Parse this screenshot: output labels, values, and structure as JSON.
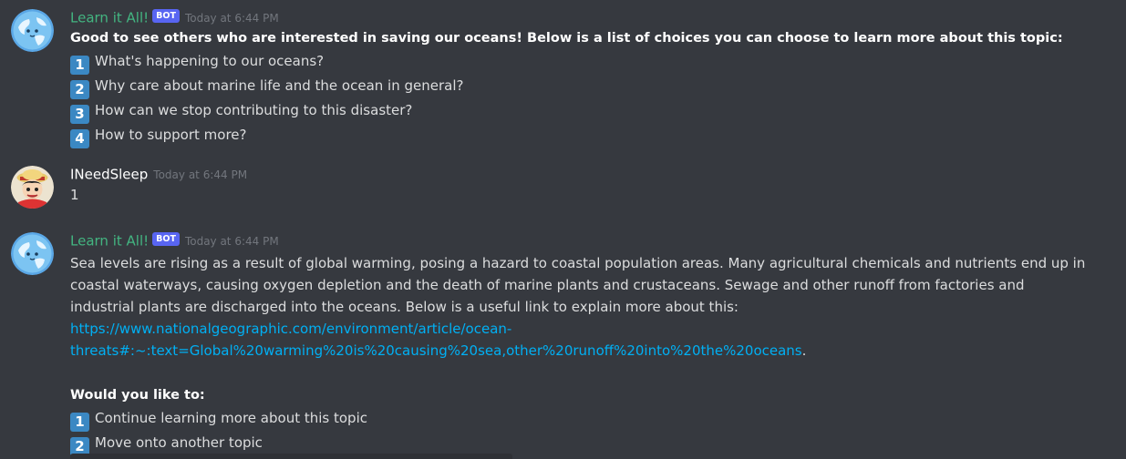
{
  "bot": {
    "name": "Learn it All!",
    "tag": "BOT",
    "avatar_icon": "globe-icon",
    "name_color": "#43b581"
  },
  "user": {
    "name": "INeedSleep",
    "avatar_icon": "anime-avatar-icon"
  },
  "messages": [
    {
      "author": "bot",
      "timestamp": "Today at 6:44 PM",
      "heading": "Good to see others who are interested in saving our oceans! Below is a list of choices you can choose to learn more about this topic:",
      "options": [
        {
          "num": "1",
          "text": "What's happening to our oceans?"
        },
        {
          "num": "2",
          "text": "Why care about marine life and the ocean in general?"
        },
        {
          "num": "3",
          "text": "How can we stop contributing to this disaster?"
        },
        {
          "num": "4",
          "text": "How to support more?"
        }
      ]
    },
    {
      "author": "user",
      "timestamp": "Today at 6:44 PM",
      "text": "1"
    },
    {
      "author": "bot",
      "timestamp": "Today at 6:44 PM",
      "paragraph": "Sea levels are rising as a result of global warming, posing a hazard to coastal population areas. Many agricultural chemicals and nutrients end up in coastal waterways, causing oxygen depletion and the death of marine plants and crustaceans. Sewage and other runoff from factories and industrial plants are discharged into the oceans. Below is a useful link to explain more about this:",
      "link_line1": "https://www.nationalgeographic.com/environment/article/ocean-",
      "link_line2": "threats#:~:text=Global%20warming%20is%20causing%20sea,other%20runoff%20into%20the%20oceans",
      "link_suffix": ".",
      "question": "Would you like to:",
      "options": [
        {
          "num": "1",
          "text": "Continue learning more about this topic"
        },
        {
          "num": "2",
          "text": "Move onto another topic"
        }
      ]
    }
  ],
  "colors": {
    "background": "#36393f",
    "text": "#dcddde",
    "link": "#00b0f4",
    "bot_tag": "#5865f2",
    "number_box": "#3b88c3",
    "timestamp": "#72767d"
  }
}
